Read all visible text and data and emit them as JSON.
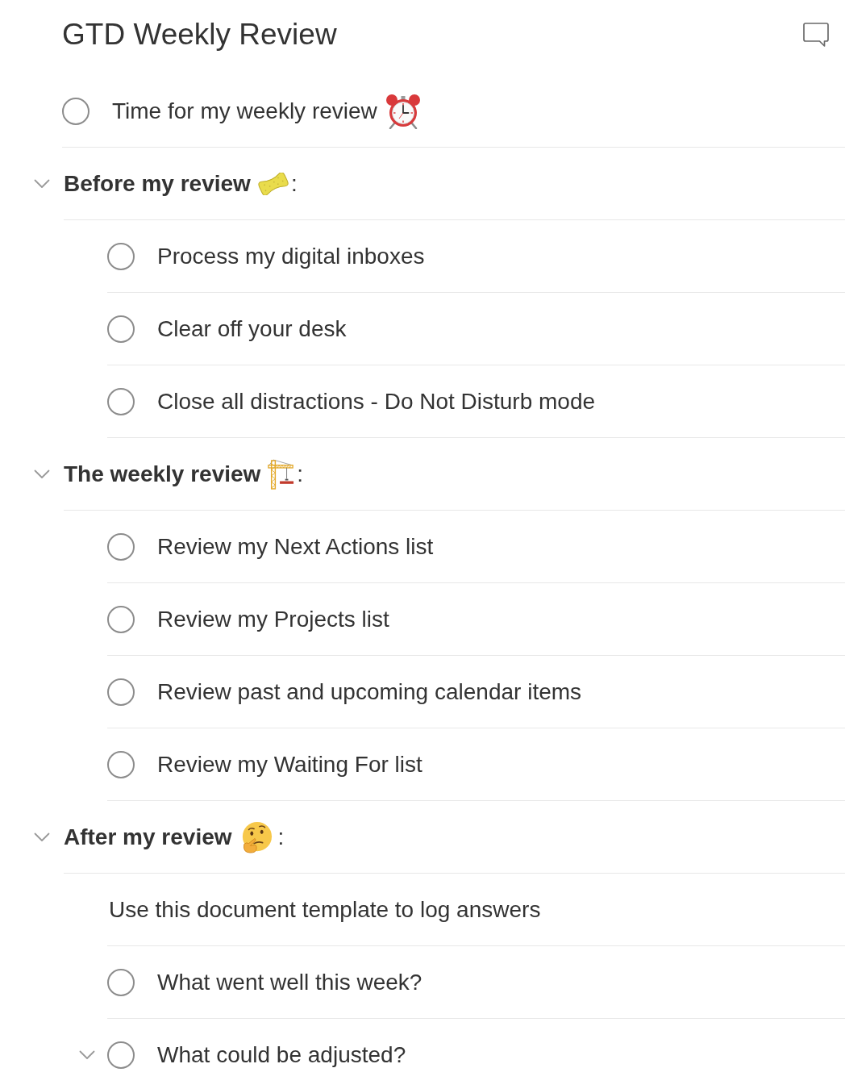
{
  "project": {
    "title": "GTD Weekly Review"
  },
  "items": [
    {
      "kind": "task",
      "text": "Time for my weekly review",
      "checked": false
    }
  ],
  "sections": [
    {
      "title": "Before my review",
      "suffix": ":",
      "expanded": true,
      "items": [
        {
          "kind": "task",
          "text": "Process my digital inboxes",
          "checked": false
        },
        {
          "kind": "task",
          "text": "Clear off your desk",
          "checked": false
        },
        {
          "kind": "task",
          "text": "Close all distractions - Do Not Disturb mode",
          "checked": false
        }
      ]
    },
    {
      "title": "The weekly review",
      "suffix": ":",
      "expanded": true,
      "items": [
        {
          "kind": "task",
          "text": "Review my Next Actions list",
          "checked": false
        },
        {
          "kind": "task",
          "text": "Review my Projects list",
          "checked": false
        },
        {
          "kind": "task",
          "text": "Review past and upcoming calendar items",
          "checked": false
        },
        {
          "kind": "task",
          "text": "Review my Waiting For list",
          "checked": false
        }
      ]
    },
    {
      "title": "After my review",
      "suffix": ":",
      "expanded": true,
      "items": [
        {
          "kind": "note",
          "text": "Use this document template to log answers"
        },
        {
          "kind": "task",
          "text": "What went well this week?",
          "checked": false
        },
        {
          "kind": "parent",
          "text": "What could be adjusted?",
          "checked": false,
          "expanded": true
        }
      ]
    }
  ]
}
